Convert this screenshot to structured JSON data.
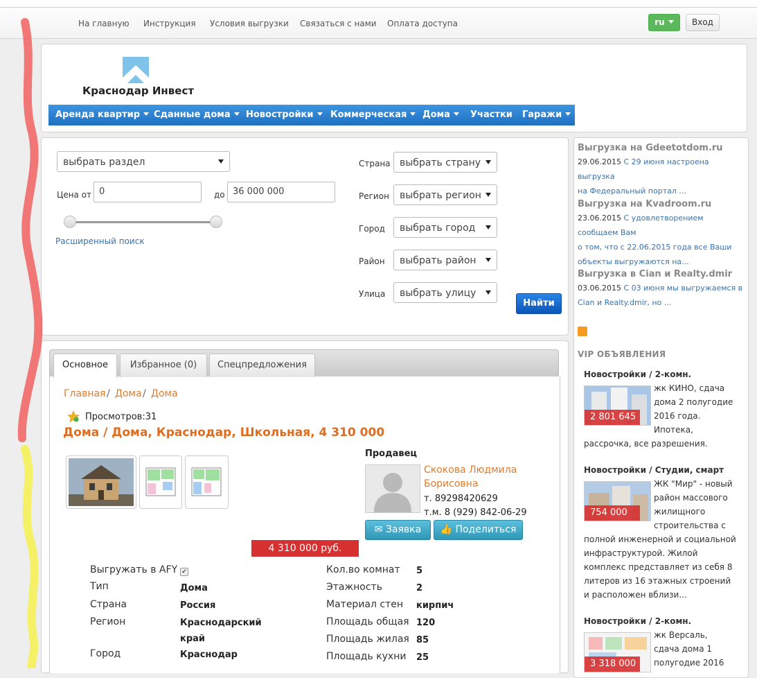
{
  "topbar": {
    "links": [
      "На главную",
      "Инструкция",
      "Условия выгрузки",
      "Связаться с нами",
      "Оплата доступа"
    ],
    "lang": "ru",
    "login": "Вход"
  },
  "logo": {
    "text": "Краснодар Инвест"
  },
  "menu": [
    {
      "label": "Аренда квартир",
      "dropdown": true
    },
    {
      "label": "Сданные дома",
      "dropdown": true
    },
    {
      "label": "Новостройки",
      "dropdown": true
    },
    {
      "label": "Коммерческая",
      "dropdown": true
    },
    {
      "label": "Дома",
      "dropdown": true
    },
    {
      "label": "Участки",
      "dropdown": false
    },
    {
      "label": "Гаражи",
      "dropdown": true
    }
  ],
  "search": {
    "section": "выбрать раздел",
    "price_from_label": "Цена от",
    "price_from": "0",
    "price_to_label": "до",
    "price_to": "36 000 000",
    "advanced": "Расширенный поиск",
    "country_label": "Страна",
    "country": "выбрать страну",
    "region_label": "Регион",
    "region": "выбрать регион",
    "city_label": "Город",
    "city": "выбрать город",
    "district_label": "Район",
    "district": "выбрать район",
    "street_label": "Улица",
    "street": "выбрать улицу",
    "find": "Найти"
  },
  "tabs": [
    "Основное",
    "Избранное (0)",
    "Спецпредложения"
  ],
  "breadcrumb": [
    "Главная",
    "Дома",
    "Дома"
  ],
  "listing": {
    "views": "Просмотров:31",
    "title": "Дома / Дома, Краснодар, Школьная, 4 310 000",
    "price": "4 310 000 руб."
  },
  "seller": {
    "heading": "Продавец",
    "name1": "Скокова Людмила",
    "name2": "Борисовна",
    "phone": "т. 89298420629",
    "mobile": "т.м. 8 (929) 842-06-29",
    "request": "Заявка",
    "share": "Поделиться"
  },
  "props_left": {
    "afy_label": "Выгружать в AFY",
    "type_label": "Тип",
    "type": "Дома",
    "country_label": "Страна",
    "country": "Россия",
    "region_label": "Регион",
    "region1": "Краснодарский",
    "region2": "край",
    "city_label": "Город",
    "city": "Краснодар"
  },
  "props_right": {
    "rooms_label": "Кол.во комнат",
    "rooms": "5",
    "floors_label": "Этажность",
    "floors": "2",
    "material_label": "Материал стен",
    "material": "кирпич",
    "area_total_label": "Площадь общая",
    "area_total": "120",
    "area_living_label": "Площадь жилая",
    "area_living": "85",
    "area_kitchen_label": "Площадь кухни",
    "area_kitchen": "25"
  },
  "news": [
    {
      "title": "Выгрузка на Gdeetotdom.ru",
      "date": "29.06.2015",
      "line1": "С 29 июня настроена выгрузка",
      "line2": "на Федеральный портал ..."
    },
    {
      "title": "Выгрузка на Kvadroom.ru",
      "date": "23.06.2015",
      "line1": "С удовлетворением сообщаем Вам",
      "line2": "о том, что с 22.06.2015 года все Ваши",
      "line3": "объекты выгружаются на..."
    },
    {
      "title": "Выгрузка в Cian и Realty.dmir",
      "date": "03.06.2015",
      "line1": "С 03 июня мы выгружаемся в",
      "line2": "Cian и Realty.dmir, но ..."
    }
  ],
  "vip": {
    "heading": "VIP ОБЪЯВЛЕНИЯ",
    "items": [
      {
        "cat": "Новостройки / 2-комн.",
        "price": "2 801 645",
        "lines": [
          "жк КИНО, сдача",
          "дома 2 полугодие",
          "2016 года.",
          "Ипотека,"
        ],
        "tail": [
          "рассрочка, все разрешения."
        ]
      },
      {
        "cat": "Новостройки / Студии, смарт",
        "price": "754 000",
        "lines": [
          "ЖК \"Мир\" - новый",
          "район массового",
          "жилищного",
          "строительства с"
        ],
        "tail": [
          "полной инженерной и социальной",
          "инфраструктурой. Жилой",
          "комплекс представляет из себя 8",
          "литеров из 16 этажных строений",
          "и расположен вблизи..."
        ]
      },
      {
        "cat": "Новостройки / 2-комн.",
        "price": "3 318 000",
        "lines": [
          "жк Версаль,",
          "сдача дома 1",
          "полугодие 2016"
        ],
        "tail": []
      }
    ]
  }
}
